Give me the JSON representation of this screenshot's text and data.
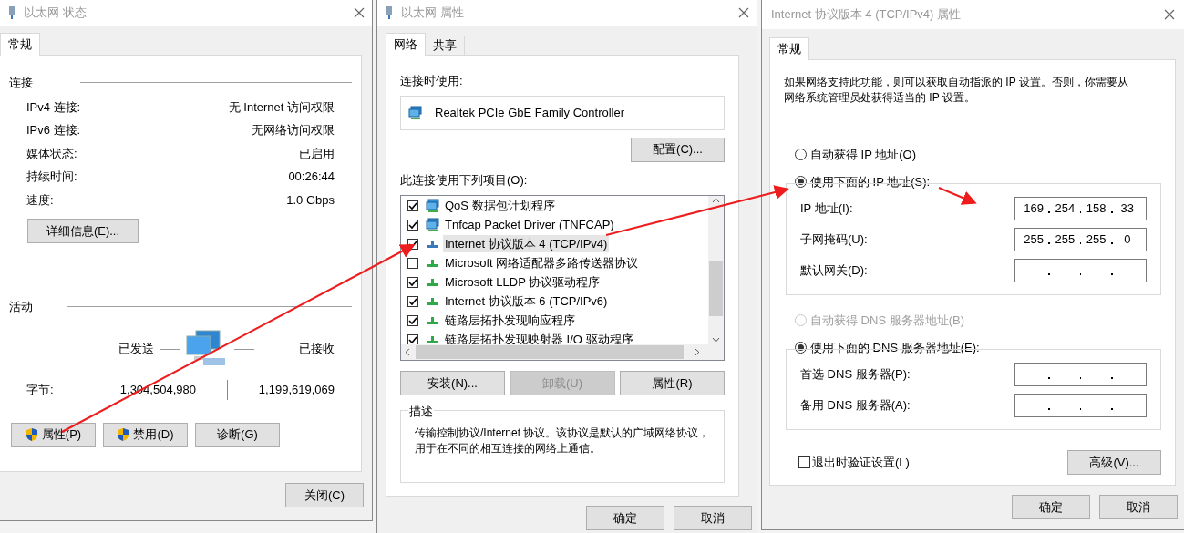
{
  "status_window": {
    "title": "以太网 状态",
    "tabs": [
      {
        "label": "常规",
        "selected": true
      }
    ],
    "connection_heading": "连接",
    "rows": [
      {
        "label": "IPv4 连接:",
        "value": "无 Internet 访问权限"
      },
      {
        "label": "IPv6 连接:",
        "value": "无网络访问权限"
      },
      {
        "label": "媒体状态:",
        "value": "已启用"
      },
      {
        "label": "持续时间:",
        "value": "00:26:44"
      },
      {
        "label": "速度:",
        "value": "1.0 Gbps"
      }
    ],
    "details_button": "详细信息(E)...",
    "activity_heading": "活动",
    "sent_label": "已发送",
    "received_label": "已接收",
    "bytes_label": "字节:",
    "bytes_sent": "1,304,504,980",
    "bytes_received": "1,199,619,069",
    "buttons": [
      {
        "label": "属性(P)",
        "shield": true
      },
      {
        "label": "禁用(D)",
        "shield": true
      },
      {
        "label": "诊断(G)",
        "shield": false
      }
    ],
    "close_button": "关闭(C)"
  },
  "properties_window": {
    "title": "以太网 属性",
    "tabs": [
      {
        "label": "网络",
        "selected": true
      },
      {
        "label": "共享",
        "selected": false
      }
    ],
    "connect_using_label": "连接时使用:",
    "adapter_name": "Realtek PCIe GbE Family Controller",
    "configure_button": "配置(C)...",
    "items_label": "此连接使用下列项目(O):",
    "items": [
      {
        "label": "QoS 数据包计划程序",
        "checked": true,
        "selected": false,
        "kind": "service"
      },
      {
        "label": "Tnfcap Packet Driver (TNFCAP)",
        "checked": true,
        "selected": false,
        "kind": "service"
      },
      {
        "label": "Internet 协议版本 4 (TCP/IPv4)",
        "checked": true,
        "selected": true,
        "kind": "protocol"
      },
      {
        "label": "Microsoft 网络适配器多路传送器协议",
        "checked": false,
        "selected": false,
        "kind": "protocol"
      },
      {
        "label": "Microsoft LLDP 协议驱动程序",
        "checked": true,
        "selected": false,
        "kind": "protocol"
      },
      {
        "label": "Internet 协议版本 6 (TCP/IPv6)",
        "checked": true,
        "selected": false,
        "kind": "protocol"
      },
      {
        "label": "链路层拓扑发现响应程序",
        "checked": true,
        "selected": false,
        "kind": "protocol"
      },
      {
        "label": "链路层拓扑发现映射器 I/O 驱动程序",
        "checked": true,
        "selected": false,
        "kind": "protocol"
      }
    ],
    "buttons": [
      {
        "label": "安装(N)...",
        "disabled": false
      },
      {
        "label": "卸载(U)",
        "disabled": true
      },
      {
        "label": "属性(R)",
        "disabled": false
      }
    ],
    "description_heading": "描述",
    "description": "传输控制协议/Internet 协议。该协议是默认的广域网络协议，用于在不同的相互连接的网络上通信。",
    "ok_button": "确定",
    "cancel_button": "取消"
  },
  "ipv4_window": {
    "title": "Internet 协议版本 4 (TCP/IPv4) 属性",
    "tabs": [
      {
        "label": "常规",
        "selected": true
      }
    ],
    "intro": "如果网络支持此功能，则可以获取自动指派的 IP 设置。否则，你需要从网络系统管理员处获得适当的 IP 设置。",
    "ip_options": [
      {
        "label": "自动获得 IP 地址(O)",
        "selected": false,
        "disabled": false
      },
      {
        "label": "使用下面的 IP 地址(S):",
        "selected": true,
        "disabled": false
      }
    ],
    "ip_fields": [
      {
        "label": "IP 地址(I):",
        "octets": [
          "169",
          "254",
          "158",
          "33"
        ]
      },
      {
        "label": "子网掩码(U):",
        "octets": [
          "255",
          "255",
          "255",
          "0"
        ]
      },
      {
        "label": "默认网关(D):"
      }
    ],
    "dns_options": [
      {
        "label": "自动获得 DNS 服务器地址(B)",
        "selected": false,
        "disabled": true
      },
      {
        "label": "使用下面的 DNS 服务器地址(E):",
        "selected": true,
        "disabled": false
      }
    ],
    "dns_fields": [
      {
        "label": "首选 DNS 服务器(P):"
      },
      {
        "label": "备用 DNS 服务器(A):"
      }
    ],
    "validate": {
      "label": "退出时验证设置(L)",
      "checked": false
    },
    "advanced_button": "高级(V)...",
    "ok_button": "确定",
    "cancel_button": "取消"
  }
}
